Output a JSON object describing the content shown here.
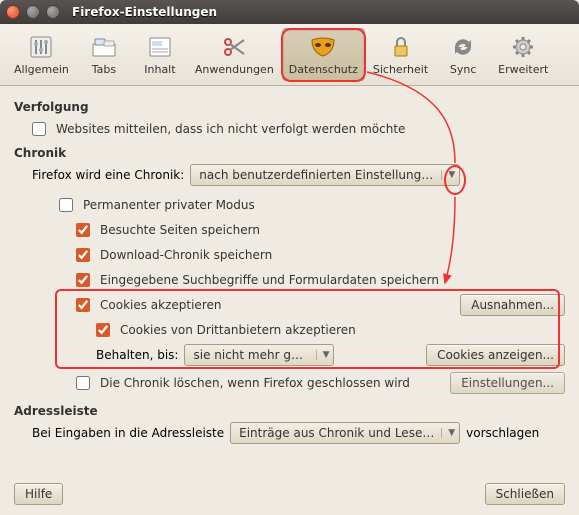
{
  "window": {
    "title": "Firefox-Einstellungen"
  },
  "toolbar": [
    {
      "name": "general",
      "label": "Allgemein"
    },
    {
      "name": "tabs",
      "label": "Tabs"
    },
    {
      "name": "content",
      "label": "Inhalt"
    },
    {
      "name": "applications",
      "label": "Anwendungen"
    },
    {
      "name": "privacy",
      "label": "Datenschutz",
      "selected": true
    },
    {
      "name": "security",
      "label": "Sicherheit"
    },
    {
      "name": "sync",
      "label": "Sync"
    },
    {
      "name": "advanced",
      "label": "Erweitert"
    }
  ],
  "sections": {
    "tracking": {
      "heading": "Verfolgung",
      "dnt": {
        "label": "Websites mitteilen, dass ich nicht verfolgt werden möchte",
        "checked": false
      }
    },
    "history": {
      "heading": "Chronik",
      "mode_label_pre": "Firefox wird eine Chronik:",
      "mode_value": "nach benutzerdefinierten Einstellungen anle...",
      "permpriv": {
        "label": "Permanenter privater Modus",
        "checked": false
      },
      "visited": {
        "label": "Besuchte Seiten speichern",
        "checked": true
      },
      "downloads": {
        "label": "Download-Chronik speichern",
        "checked": true
      },
      "searchform": {
        "label": "Eingegebene Suchbegriffe und Formulardaten speichern",
        "checked": true
      },
      "cookies": {
        "label": "Cookies akzeptieren",
        "checked": true
      },
      "exceptions_btn": "Ausnahmen...",
      "thirdparty": {
        "label": "Cookies von Drittanbietern akzeptieren",
        "checked": true
      },
      "keepuntil_label": "Behalten, bis:",
      "keepuntil_value": "sie nicht mehr gültig ...",
      "showcookies_btn": "Cookies anzeigen...",
      "clearonclose": {
        "label": "Die Chronik löschen, wenn Firefox geschlossen wird",
        "checked": false
      },
      "clearonclose_settings_btn": "Einstellungen..."
    },
    "locationbar": {
      "heading": "Adressleiste",
      "label_pre": "Bei Eingaben in die Adressleiste",
      "value": "Einträge aus Chronik und Lesezeic...",
      "label_post": "vorschlagen"
    }
  },
  "buttons": {
    "help": "Hilfe",
    "close": "Schließen"
  }
}
